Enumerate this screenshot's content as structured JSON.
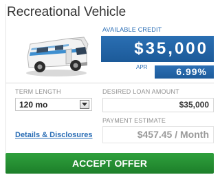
{
  "offer": {
    "title": "Recreational Vehicle",
    "image_icon": "rv-vehicle-icon",
    "available_credit_label": "AVAILABLE CREDIT",
    "available_credit_value": "$35,000",
    "apr_label": "APR",
    "apr_value": "6.99%"
  },
  "form": {
    "term_length_label": "TERM LENGTH",
    "term_length_selected": "120 mo",
    "desired_amount_label": "DESIRED LOAN AMOUNT",
    "desired_amount_value": "$35,000",
    "payment_estimate_label": "PAYMENT ESTIMATE",
    "payment_estimate_value": "$457.45 / Month",
    "details_link": "Details & Disclosures"
  },
  "actions": {
    "accept_label": "ACCEPT OFFER"
  },
  "colors": {
    "accent_blue": "#1f5fa0",
    "accept_green": "#25913a"
  }
}
